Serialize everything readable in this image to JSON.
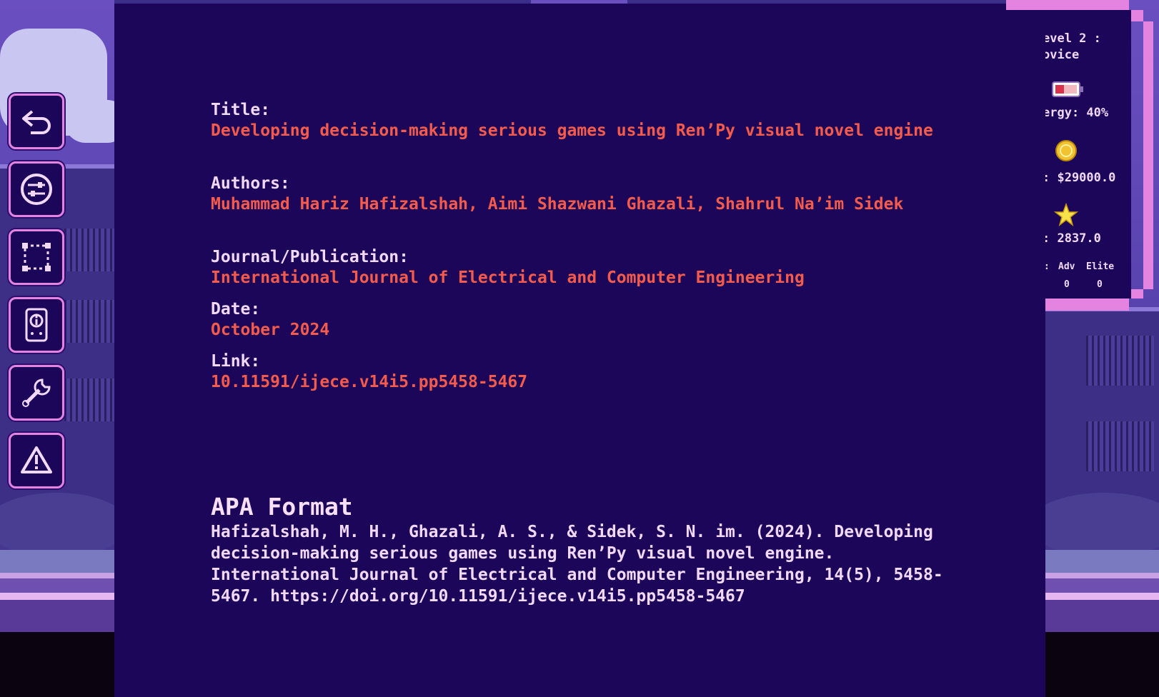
{
  "reference": {
    "title_label": "Title:",
    "title": "Developing decision-making serious games using Ren’Py visual novel engine",
    "authors_label": "Authors:",
    "authors": "Muhammad Hariz Hafizalshah, Aimi Shazwani Ghazali, Shahrul Na’im Sidek",
    "journal_label": "Journal/Publication:",
    "journal": "International Journal of Electrical and Computer Engineering",
    "date_label": "Date:",
    "date": "October 2024",
    "link_label": "Link:",
    "link": "10.11591/ijece.v14i5.pp5458-5467"
  },
  "apa": {
    "heading": "APA Format",
    "citation": "Hafizalshah, M. H., Ghazali, A. S., & Sidek, S. N. im. (2024). Developing decision-making serious games using Ren’Py visual novel engine. International Journal of Electrical and Computer Engineering, 14(5), 5458-5467. https://doi.org/10.11591/ijece.v14i5.pp5458-5467"
  },
  "toolbar": [
    {
      "name": "back",
      "icon": "back-arrow-icon"
    },
    {
      "name": "settings",
      "icon": "sliders-icon"
    },
    {
      "name": "select",
      "icon": "selection-frame-icon"
    },
    {
      "name": "info",
      "icon": "device-info-icon"
    },
    {
      "name": "tools",
      "icon": "wrench-icon"
    },
    {
      "name": "warning",
      "icon": "warning-icon"
    }
  ],
  "stats": {
    "level_line1": "evel 2 :",
    "level_line2": "ovice",
    "energy": "ergy: 40%",
    "energy_level": 0.4,
    "money": ": $29000.0",
    "xp": ": 2837.0",
    "rank_prefix": ":",
    "adv_label": "Adv",
    "elite_label": "Elite",
    "adv_value": "0",
    "elite_value": "0"
  },
  "colors": {
    "panel": "#1c0659",
    "accent_pink": "#e483e0",
    "label_text": "#f1d9f5",
    "value_text": "#f45b4c"
  }
}
